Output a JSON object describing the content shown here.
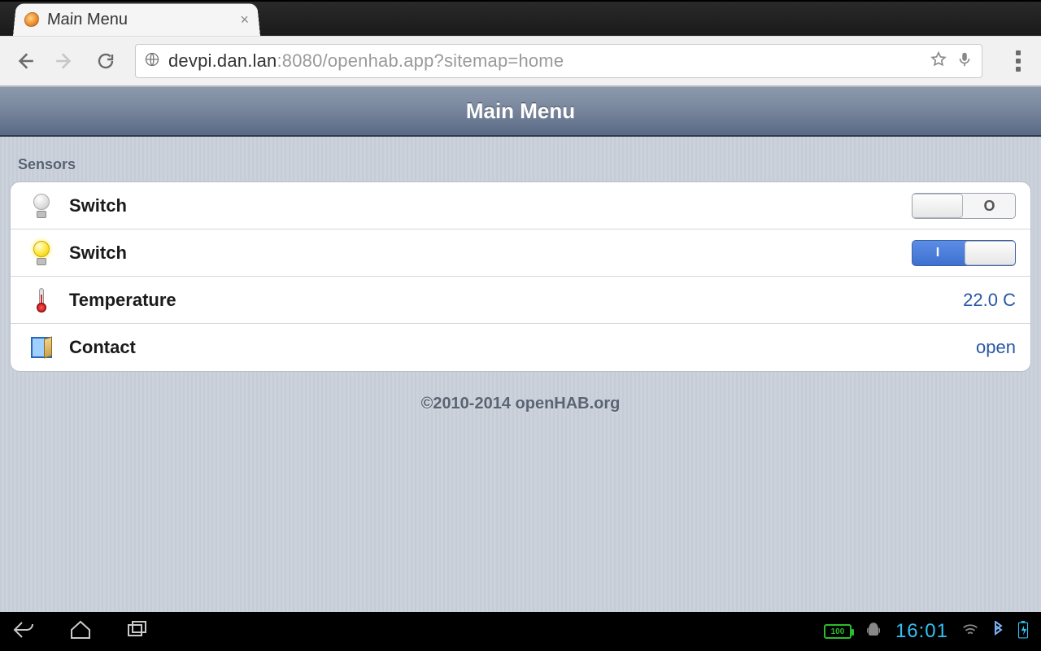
{
  "browser": {
    "tab_title": "Main Menu",
    "url_host": "devpi.dan.lan",
    "url_port": ":8080",
    "url_path": "/openhab.app?sitemap=home"
  },
  "app": {
    "header_title": "Main Menu",
    "section_title": "Sensors",
    "footer": "©2010-2014 openHAB.org",
    "rows": {
      "switch_off": {
        "label": "Switch",
        "toggle_label": "O"
      },
      "switch_on": {
        "label": "Switch",
        "toggle_label": "I"
      },
      "temperature": {
        "label": "Temperature",
        "value": "22.0 C"
      },
      "contact": {
        "label": "Contact",
        "value": "open"
      }
    }
  },
  "android": {
    "battery_badge": "100",
    "clock": "16:01"
  }
}
